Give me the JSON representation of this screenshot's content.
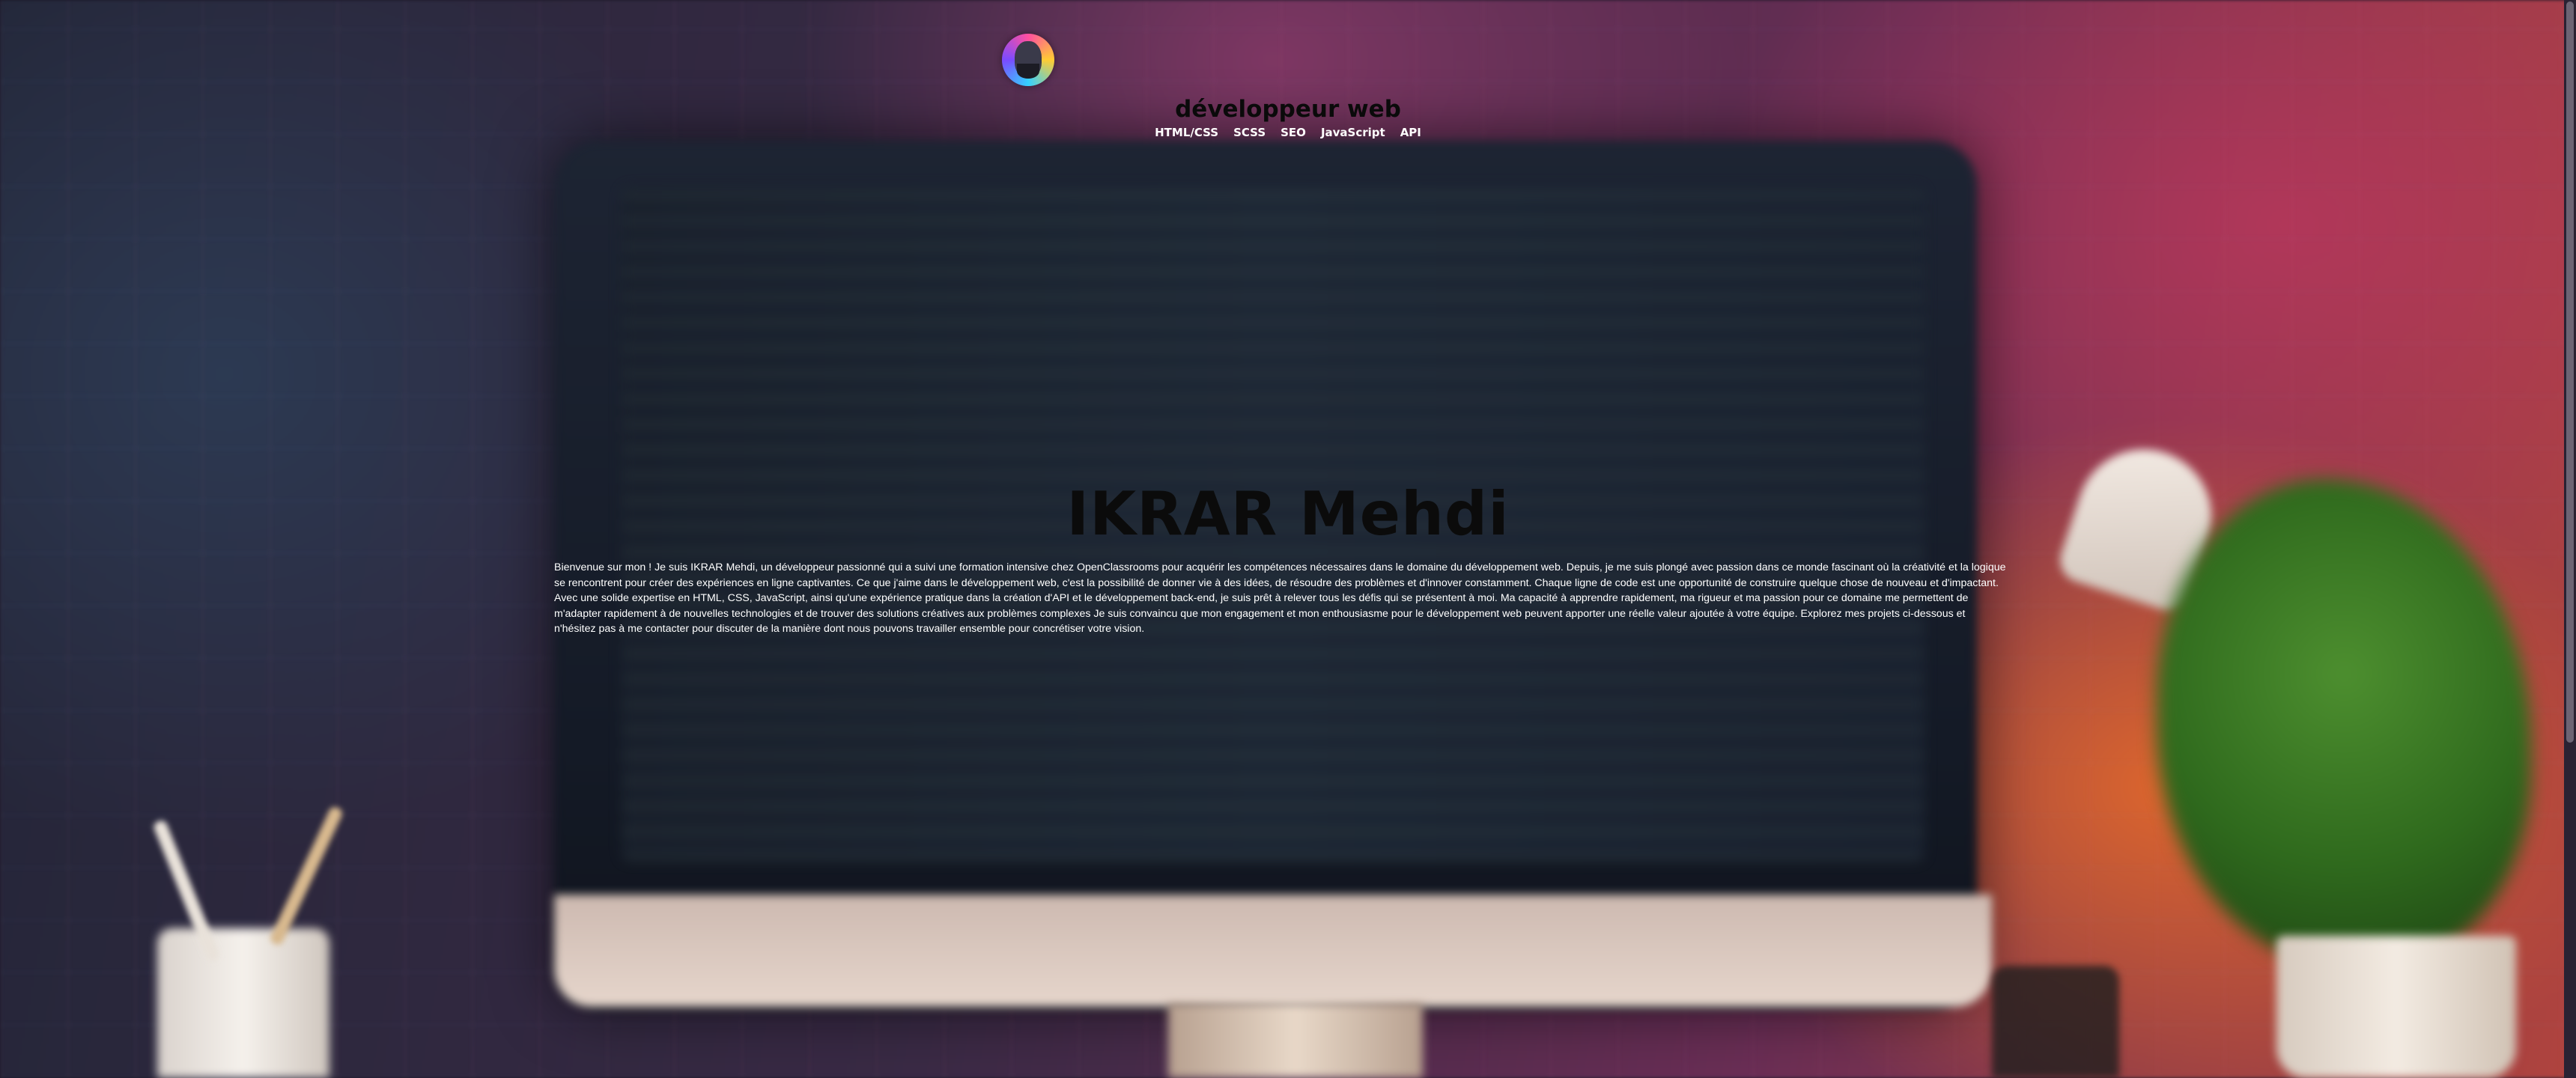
{
  "header": {
    "avatar_alt": "IKRAR Mehdi",
    "subtitle": "développeur web",
    "nav": [
      {
        "label": "HTML/CSS"
      },
      {
        "label": "SCSS"
      },
      {
        "label": "SEO"
      },
      {
        "label": "JavaScript"
      },
      {
        "label": "API"
      }
    ]
  },
  "main": {
    "title": "IKRAR Mehdi",
    "intro": "Bienvenue sur mon ! Je suis IKRAR Mehdi, un développeur passionné qui a suivi une formation intensive chez OpenClassrooms pour acquérir les compétences nécessaires dans le domaine du développement web. Depuis, je me suis plongé avec passion dans ce monde fascinant où la créativité et la logique se rencontrent pour créer des expériences en ligne captivantes. Ce que j'aime dans le développement web, c'est la possibilité de donner vie à des idées, de résoudre des problèmes et d'innover constamment. Chaque ligne de code est une opportunité de construire quelque chose de nouveau et d'impactant. Avec une solide expertise en HTML, CSS, JavaScript, ainsi qu'une expérience pratique dans la création d'API et le développement back-end, je suis prêt à relever tous les défis qui se présentent à moi. Ma capacité à apprendre rapidement, ma rigueur et ma passion pour ce domaine me permettent de m'adapter rapidement à de nouvelles technologies et de trouver des solutions créatives aux problèmes complexes Je suis convaincu que mon engagement et mon enthousiasme pour le développement web peuvent apporter une réelle valeur ajoutée à votre équipe. Explorez mes projets ci-dessous et n'hésitez pas à me contacter pour discuter de la manière dont nous pouvons travailler ensemble pour concrétiser votre vision."
  }
}
